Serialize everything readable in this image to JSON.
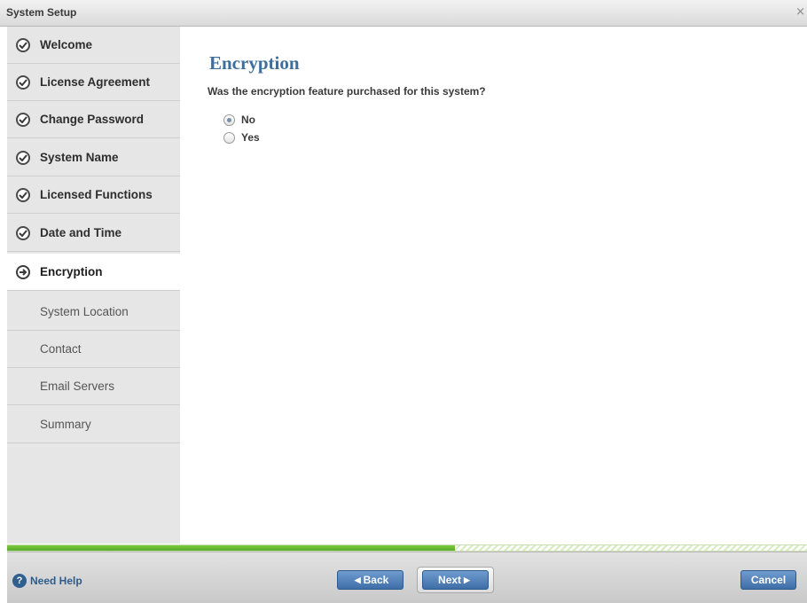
{
  "window": {
    "title": "System Setup",
    "close_glyph": "×"
  },
  "sidebar": {
    "items": [
      {
        "label": "Welcome",
        "state": "done"
      },
      {
        "label": "License Agreement",
        "state": "done"
      },
      {
        "label": "Change Password",
        "state": "done"
      },
      {
        "label": "System Name",
        "state": "done"
      },
      {
        "label": "Licensed Functions",
        "state": "done"
      },
      {
        "label": "Date and Time",
        "state": "done"
      },
      {
        "label": "Encryption",
        "state": "current"
      },
      {
        "label": "System Location",
        "state": "pending"
      },
      {
        "label": "Contact",
        "state": "pending"
      },
      {
        "label": "Email Servers",
        "state": "pending"
      },
      {
        "label": "Summary",
        "state": "pending"
      }
    ]
  },
  "main": {
    "title": "Encryption",
    "question": "Was the encryption feature purchased for this system?",
    "options": [
      {
        "label": "No",
        "selected": true
      },
      {
        "label": "Yes",
        "selected": false
      }
    ]
  },
  "progress": {
    "fraction": 0.56,
    "fill_color": "#6cbd35"
  },
  "footer": {
    "help_label": "Need Help",
    "back_label": "Back",
    "next_label": "Next",
    "cancel_label": "Cancel"
  },
  "colors": {
    "accent": "#3e6e9c",
    "button": "#4a78b0"
  },
  "icons": {
    "done": "check-circle-icon",
    "current": "arrow-right-circle-icon",
    "help": "question-circle-icon"
  }
}
